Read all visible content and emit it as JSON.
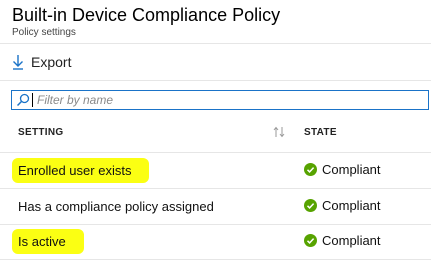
{
  "header": {
    "title": "Built-in Device Compliance Policy",
    "subtitle": "Policy settings"
  },
  "toolbar": {
    "export_label": "Export",
    "export_icon": "download-arrow-icon"
  },
  "filter": {
    "placeholder": "Filter by name",
    "value": "",
    "icon": "search-icon"
  },
  "table": {
    "columns": [
      "SETTING",
      "STATE"
    ],
    "sort_icon": "sort-arrows-icon",
    "rows": [
      {
        "setting": "Enrolled user exists",
        "state": "Compliant",
        "highlighted": true
      },
      {
        "setting": "Has a compliance policy assigned",
        "state": "Compliant",
        "highlighted": false
      },
      {
        "setting": "Is active",
        "state": "Compliant",
        "highlighted": true
      }
    ]
  },
  "colors": {
    "accent": "#1a73c8",
    "compliant_green": "#57a300",
    "highlight_yellow": "#fbff13"
  }
}
